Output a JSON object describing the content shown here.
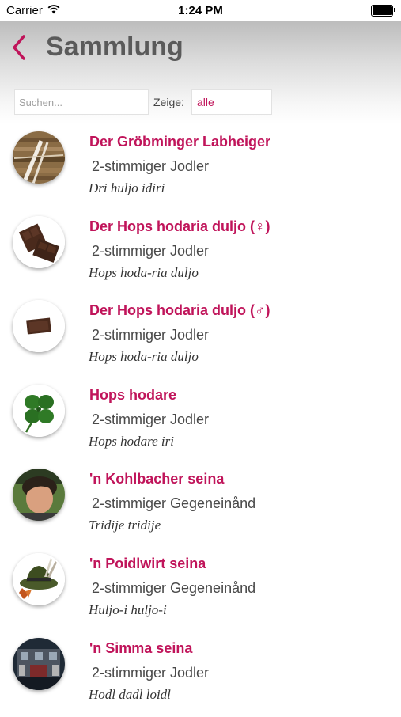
{
  "status_bar": {
    "carrier": "Carrier",
    "time": "1:24 PM",
    "battery_level": 1.0
  },
  "header": {
    "back_icon": "chevron-left-icon",
    "title": "Sammlung"
  },
  "search": {
    "placeholder": "Suchen...",
    "value": ""
  },
  "filter": {
    "label": "Zeige:",
    "value": "alle"
  },
  "colors": {
    "accent": "#c0145a",
    "title_gray": "#5a5a5a"
  },
  "items": [
    {
      "title": "Der Gröbminger Labheiger",
      "subtitle": "2-stimmiger Jodler",
      "lyric": "Dri huljo idiri",
      "thumbnail": "wooden-sticks-image"
    },
    {
      "title": "Der Hops hodaria duljo (♀)",
      "subtitle": "2-stimmiger Jodler",
      "lyric": "Hops hoda-ria duljo",
      "thumbnail": "chocolate-pieces-image"
    },
    {
      "title": "Der Hops hodaria duljo (♂)",
      "subtitle": "2-stimmiger Jodler",
      "lyric": "Hops hoda-ria duljo",
      "thumbnail": "chocolate-piece-image"
    },
    {
      "title": "Hops hodare",
      "subtitle": "2-stimmiger Jodler",
      "lyric": "Hops hodare iri",
      "thumbnail": "four-leaf-clover-image"
    },
    {
      "title": "'n Kohlbacher seina",
      "subtitle": "2-stimmiger Gegeneinånd",
      "lyric": "Tridije tridije",
      "thumbnail": "boy-portrait-image"
    },
    {
      "title": "'n Poidlwirt seina",
      "subtitle": "2-stimmiger Gegeneinånd",
      "lyric": "Huljo-i huljo-i",
      "thumbnail": "alpine-hat-image"
    },
    {
      "title": "'n Simma seina",
      "subtitle": "2-stimmiger Jodler",
      "lyric": "Hodl dadl loidl",
      "thumbnail": "building-scene-image"
    }
  ]
}
